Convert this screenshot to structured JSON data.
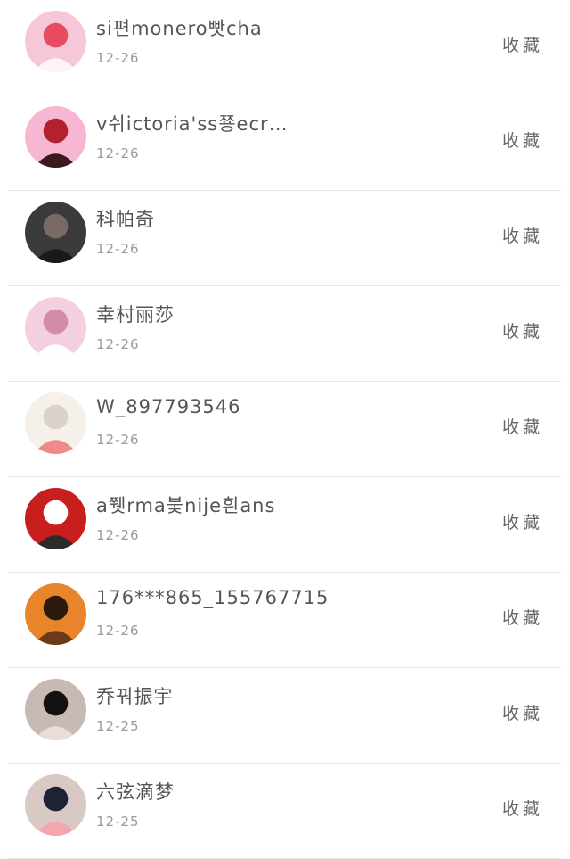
{
  "favorite_label": "收藏",
  "items": [
    {
      "name": "si편monero빳cha",
      "date": "12-26",
      "avatar": "cake-avatar",
      "colors": [
        "#f6c7d9",
        "#e84a5f",
        "#fff3f6"
      ]
    },
    {
      "name": "v쉬ictoria'ss쭁ecr…",
      "date": "12-26",
      "avatar": "red-character-avatar",
      "colors": [
        "#f7b7d2",
        "#b3202e",
        "#3a1a1a"
      ]
    },
    {
      "name": "科帕奇",
      "date": "12-26",
      "avatar": "girl-portrait-avatar",
      "colors": [
        "#3b3b3b",
        "#7a6a66",
        "#1a1a1a"
      ]
    },
    {
      "name": "幸村丽莎",
      "date": "12-26",
      "avatar": "anime-girl-avatar",
      "colors": [
        "#f4cfe0",
        "#d48aa9",
        "#ffffff"
      ]
    },
    {
      "name": "W_897793546",
      "date": "12-26",
      "avatar": "twin-girls-avatar",
      "colors": [
        "#f5f0ea",
        "#d9d3cc",
        "#f08a8a"
      ]
    },
    {
      "name": "a쮓rma붗nije흰ans",
      "date": "12-26",
      "avatar": "red-dress-avatar",
      "colors": [
        "#c81e1e",
        "#ffffff",
        "#2b2b2b"
      ]
    },
    {
      "name": "176***865_155767715",
      "date": "12-26",
      "avatar": "halloween-avatar",
      "colors": [
        "#e8842a",
        "#2a1a10",
        "#6b3a18"
      ]
    },
    {
      "name": "乔꿔振宇",
      "date": "12-25",
      "avatar": "dark-hair-boy-avatar",
      "colors": [
        "#c9b9b4",
        "#111111",
        "#e8ddd8"
      ]
    },
    {
      "name": "六弦滴梦",
      "date": "12-25",
      "avatar": "cat-hood-avatar",
      "colors": [
        "#d9c9c4",
        "#1f2233",
        "#f2a7b0"
      ]
    }
  ]
}
